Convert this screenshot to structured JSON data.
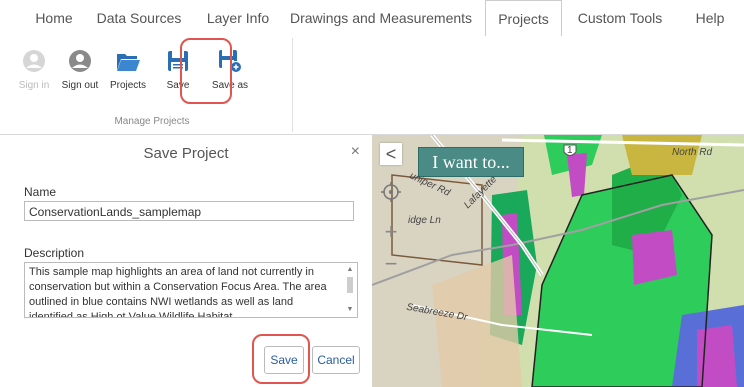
{
  "tabs": [
    {
      "label": "Home"
    },
    {
      "label": "Data Sources"
    },
    {
      "label": "Layer Info"
    },
    {
      "label": "Drawings and Measurements"
    },
    {
      "label": "Projects"
    },
    {
      "label": "Custom Tools"
    },
    {
      "label": "Help"
    }
  ],
  "active_tab": "Projects",
  "ribbon": {
    "group_label": "Manage Projects",
    "buttons": [
      {
        "label": "Sign in",
        "icon": "user-icon",
        "disabled": true
      },
      {
        "label": "Sign out",
        "icon": "user-icon",
        "disabled": false
      },
      {
        "label": "Projects",
        "icon": "folder-open-icon",
        "disabled": false
      },
      {
        "label": "Save",
        "icon": "floppy-disk-icon",
        "disabled": false
      },
      {
        "label": "Save as",
        "icon": "floppy-disk-plus-icon",
        "disabled": false
      }
    ]
  },
  "panel": {
    "title": "Save Project",
    "close_glyph": "×",
    "name_label": "Name",
    "name_value": "ConservationLands_samplemap",
    "description_label": "Description",
    "description_value": "This sample map highlights an area of land not currently in conservation but within a Conservation Focus Area.  The area outlined in blue contains NWI wetlands as well as land identified as High ot Value Wildlife Habitat",
    "save_label": "Save",
    "cancel_label": "Cancel"
  },
  "map": {
    "collapse_glyph": "<",
    "i_want_to": "I want to...",
    "zoom_in": "+",
    "zoom_out": "−",
    "route_shield": "1",
    "labels": {
      "north_rd": "North Rd",
      "lafayette": "Lafayette",
      "uniper_rd": "uniper Rd",
      "ridge_ln": "idge Ln",
      "seabreeze_dr": "Seabreeze Dr"
    }
  },
  "colors": {
    "highlight": "#e0554f",
    "icon_blue": "#2a6fb5",
    "map_teal": "#4b8b86",
    "link_blue": "#2a5d9f"
  }
}
